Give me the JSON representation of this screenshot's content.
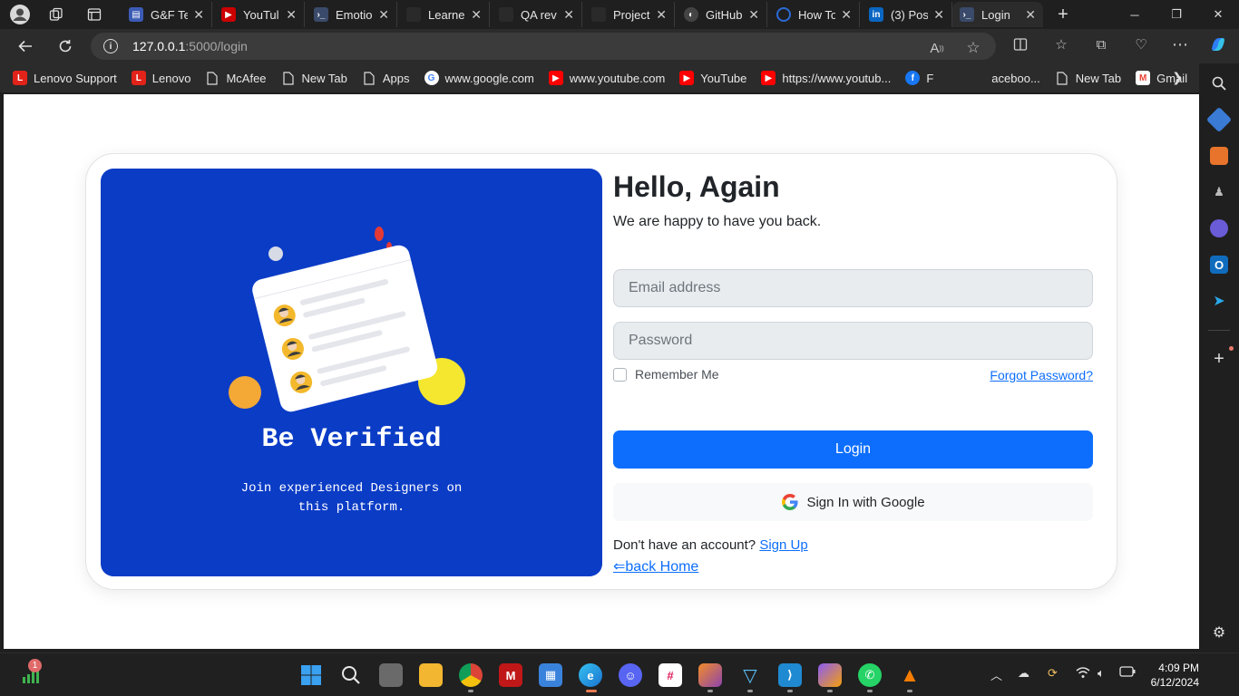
{
  "browser": {
    "tabs": [
      {
        "title": "G&F Te",
        "icon": "generic-app-icon",
        "color": "#3b5bb5"
      },
      {
        "title": "YouTul",
        "icon": "youtube-icon",
        "color": "#cc0000"
      },
      {
        "title": "Emotio",
        "icon": "terminal-icon",
        "color": "#3a4a6a"
      },
      {
        "title": "Learne",
        "icon": "generic-page-icon",
        "color": "#2a2a2a"
      },
      {
        "title": "QA rev",
        "icon": "generic-page-icon",
        "color": "#2a2a2a"
      },
      {
        "title": "Project",
        "icon": "generic-page-icon",
        "color": "#2a2a2a"
      },
      {
        "title": "GitHub",
        "icon": "github-icon",
        "color": "#444444"
      },
      {
        "title": "How To",
        "icon": "loading-icon",
        "color": "#2b6ad6"
      },
      {
        "title": "(3) Pos",
        "icon": "linkedin-icon",
        "color": "#0a66c2"
      },
      {
        "title": "Login",
        "icon": "terminal-icon",
        "color": "#3a4a6a"
      }
    ],
    "address": {
      "host": "127.0.0.1",
      "path": ":5000/login"
    },
    "bookmarks": [
      {
        "label": "Lenovo Support",
        "icon": "lenovo-icon",
        "color": "#e2231a"
      },
      {
        "label": "Lenovo",
        "icon": "lenovo-icon",
        "color": "#e2231a"
      },
      {
        "label": "McAfee",
        "icon": "page-icon",
        "color": "#555555"
      },
      {
        "label": "New Tab",
        "icon": "page-icon",
        "color": "#555555"
      },
      {
        "label": "Apps",
        "icon": "page-icon",
        "color": "#555555"
      },
      {
        "label": "www.google.com",
        "icon": "google-icon",
        "color": "#ffffff"
      },
      {
        "label": "www.youtube.com",
        "icon": "youtube-icon",
        "color": "#ff0000"
      },
      {
        "label": "YouTube",
        "icon": "youtube-icon",
        "color": "#ff0000"
      },
      {
        "label": "https://www.youtub...",
        "icon": "youtube-icon",
        "color": "#ff0000"
      },
      {
        "label": "F",
        "icon": "facebook-icon",
        "color": "#1877f2"
      },
      {
        "label": "aceboo...",
        "icon": "none",
        "color": "#2b2b2b"
      },
      {
        "label": "New Tab",
        "icon": "page-icon",
        "color": "#555555"
      },
      {
        "label": "Gmail",
        "icon": "gmail-icon",
        "color": "#ffffff"
      }
    ]
  },
  "page": {
    "hero": {
      "title": "Be Verified",
      "subtitle": "Join experienced Designers on this platform."
    },
    "form": {
      "title": "Hello, Again",
      "subtitle": "We are happy to have you back.",
      "email_placeholder": "Email address",
      "password_placeholder": "Password",
      "remember_label": "Remember Me",
      "forgot_label": "Forgot Password?",
      "login_label": "Login",
      "google_label": "Sign In with Google",
      "signup_prompt": "Don't have an account?",
      "signup_link": "Sign Up",
      "back_home": "⇐back Home"
    },
    "colors": {
      "hero_bg": "#0b3cc6",
      "primary": "#0d6efd"
    }
  },
  "taskbar": {
    "badge_count": "1",
    "time": "4:09 PM",
    "date": "6/12/2024"
  }
}
